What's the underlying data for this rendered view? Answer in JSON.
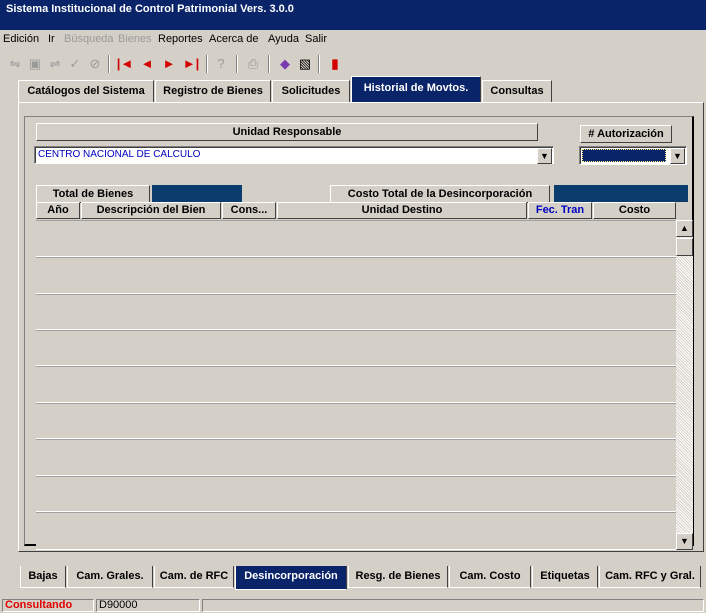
{
  "window": {
    "title": "Sistema Institucional de Control Patrimonial Vers. 3.0.0"
  },
  "menu": [
    {
      "label": "Edición",
      "enabled": true
    },
    {
      "label": "Ir",
      "enabled": true
    },
    {
      "label": "Búsqueda",
      "enabled": false
    },
    {
      "label": "Bienes",
      "enabled": false
    },
    {
      "label": "Reportes",
      "enabled": true
    },
    {
      "label": "Acerca de",
      "enabled": true
    },
    {
      "label": "Ayuda",
      "enabled": true
    },
    {
      "label": "Salir",
      "enabled": true
    }
  ],
  "toolbar": [
    {
      "icon": "add-icon",
      "enabled": false
    },
    {
      "icon": "clear-icon",
      "enabled": false
    },
    {
      "icon": "edit-icon",
      "enabled": false
    },
    {
      "icon": "check-icon",
      "enabled": false
    },
    {
      "icon": "cancel-icon",
      "enabled": false
    },
    {
      "icon": "first-record-icon",
      "enabled": true
    },
    {
      "icon": "previous-record-icon",
      "enabled": true
    },
    {
      "icon": "next-record-icon",
      "enabled": true
    },
    {
      "icon": "last-record-icon",
      "enabled": true
    },
    {
      "icon": "query-icon",
      "enabled": false
    },
    {
      "icon": "print-icon",
      "enabled": false
    },
    {
      "icon": "erase-icon",
      "enabled": true
    },
    {
      "icon": "save-icon",
      "enabled": true
    },
    {
      "icon": "exit-icon",
      "enabled": true
    }
  ],
  "top_tabs": [
    {
      "label": "Catálogos del Sistema",
      "active": false
    },
    {
      "label": "Registro de Bienes",
      "active": false
    },
    {
      "label": "Solicitudes",
      "active": false
    },
    {
      "label": "Historial de Movtos.",
      "active": true
    },
    {
      "label": "Consultas",
      "active": false
    }
  ],
  "form": {
    "unidad_label": "Unidad Responsable",
    "unidad_value": "CENTRO NACIONAL DE CALCULO",
    "autorizacion_label": "# Autorización",
    "autorizacion_value": "",
    "total_bienes_label": "Total de Bienes",
    "total_bienes_value": "",
    "costo_total_label": "Costo Total de la Desincorporación",
    "costo_total_value": ""
  },
  "grid": {
    "columns": [
      "Año",
      "Descripción del Bien",
      "Cons...",
      "Unidad Destino",
      "Fec. Tran",
      "Costo"
    ],
    "rows": 9
  },
  "bottom_tabs": [
    {
      "label": "Bajas",
      "active": false
    },
    {
      "label": "Cam. Grales.",
      "active": false
    },
    {
      "label": "Cam. de RFC",
      "active": false
    },
    {
      "label": "Desincorporación",
      "active": true
    },
    {
      "label": "Resg. de Bienes",
      "active": false
    },
    {
      "label": "Cam. Costo",
      "active": false
    },
    {
      "label": "Etiquetas",
      "active": false
    },
    {
      "label": "Cam. RFC y Gral.",
      "active": false
    }
  ],
  "status": {
    "mode": "Consultando",
    "code": "D90000"
  },
  "colors": {
    "title_bar": "#0a246a",
    "field_dark": "#0a3c6e",
    "status_mode": "#e00000"
  }
}
